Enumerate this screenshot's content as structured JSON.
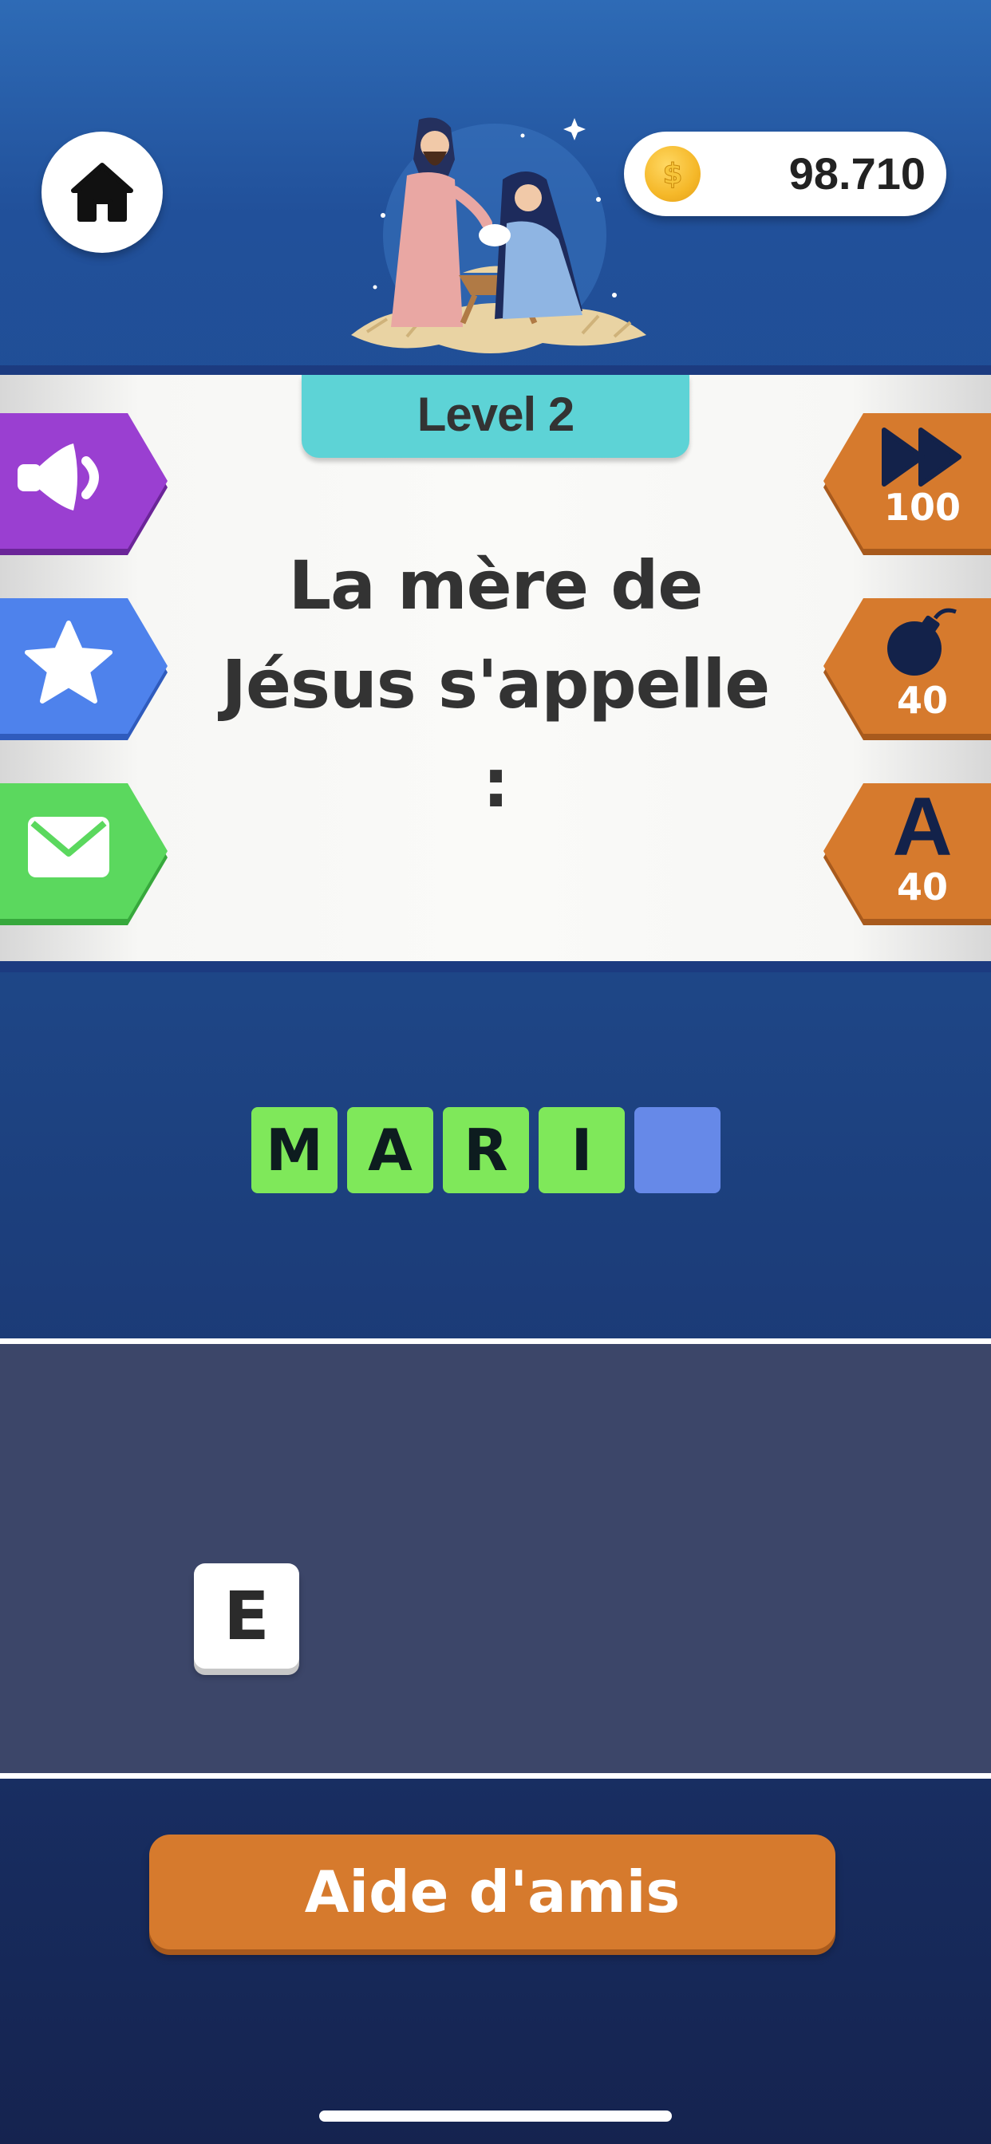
{
  "header": {
    "home_icon": "home-icon",
    "coins": "98.710",
    "coin_icon": "coin-icon",
    "coin_symbol": "$",
    "illustration": "nativity-scene"
  },
  "level": {
    "label": "Level 2"
  },
  "question": {
    "text": "La mère de Jésus s'appelle :"
  },
  "left_actions": [
    {
      "name": "sound",
      "icon": "speaker-icon",
      "color": "#9a3fd1"
    },
    {
      "name": "favorite",
      "icon": "star-icon",
      "color": "#4e82ec"
    },
    {
      "name": "share",
      "icon": "envelope-icon",
      "color": "#5bd85e"
    }
  ],
  "right_actions": [
    {
      "name": "skip",
      "icon": "fast-forward-icon",
      "count": "100",
      "color": "#d67a2d"
    },
    {
      "name": "bomb",
      "icon": "bomb-icon",
      "count": "40",
      "color": "#d67a2d"
    },
    {
      "name": "reveal-letter",
      "letter": "A",
      "count": "40",
      "color": "#d67a2d"
    }
  ],
  "answer": {
    "slots": [
      "M",
      "A",
      "R",
      "I",
      ""
    ],
    "filled_color": "#7fe85a",
    "empty_color": "#6689e8"
  },
  "letters": [
    "E"
  ],
  "help_button": {
    "label": "Aide d'amis"
  }
}
